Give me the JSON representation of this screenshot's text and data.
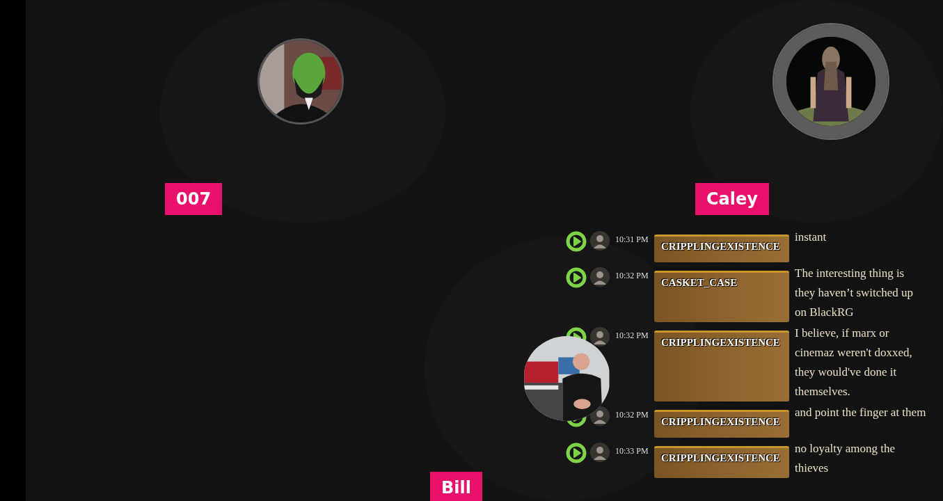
{
  "participants": [
    {
      "name": "007",
      "speaking": false
    },
    {
      "name": "Caley",
      "speaking": true
    },
    {
      "name": "Bill"
    }
  ],
  "chat": {
    "messages": [
      {
        "time": "10:31 PM",
        "user": "CRIPPLINGEXISTENCE",
        "text": "instant"
      },
      {
        "time": "10:32 PM",
        "user": "CASKET_CASE",
        "text": "The interesting thing is they haven’t switched up on BlackRG"
      },
      {
        "time": "10:32 PM",
        "user": "CRIPPLINGEXISTENCE",
        "text": "I believe, if marx or cinemaz weren't doxxed, they would've done it themselves."
      },
      {
        "time": "10:32 PM",
        "user": "CRIPPLINGEXISTENCE",
        "text": "and point the finger at them"
      },
      {
        "time": "10:33 PM",
        "user": "CRIPPLINGEXISTENCE",
        "text": "no loyalty among the thieves"
      }
    ]
  }
}
